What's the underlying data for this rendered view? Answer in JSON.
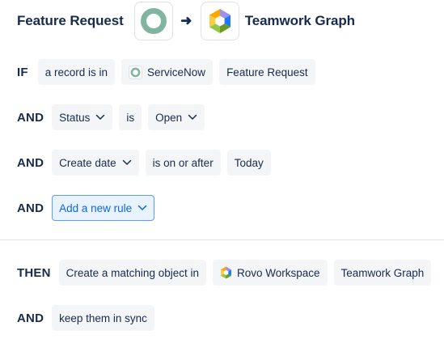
{
  "header": {
    "source_title": "Feature Request",
    "arrow": "➜",
    "target_title": "Teamwork Graph",
    "source_icon": "servicenow-logo-icon",
    "target_icon": "rovo-logo-icon"
  },
  "rules": {
    "if_row": {
      "keyword": "IF",
      "condition": "a record is in",
      "app": "ServiceNow",
      "object": "Feature Request"
    },
    "status_row": {
      "keyword": "AND",
      "field": "Status",
      "operator": "is",
      "value": "Open"
    },
    "date_row": {
      "keyword": "AND",
      "field": "Create date",
      "operator": "is on or after",
      "value": "Today"
    },
    "add_row": {
      "keyword": "AND",
      "label": "Add a new rule"
    }
  },
  "actions": {
    "then_row": {
      "keyword": "THEN",
      "action": "Create a matching object in",
      "app": "Rovo Workspace",
      "object": "Teamwork Graph"
    },
    "sync_row": {
      "keyword": "AND",
      "label": "keep them in sync"
    }
  },
  "colors": {
    "text": "#172b4d",
    "chip_bg": "#f4f5f7",
    "accent": "#0c66e4",
    "accent_bg": "#e9f2ff",
    "servicenow_green": "#81b5a1"
  }
}
